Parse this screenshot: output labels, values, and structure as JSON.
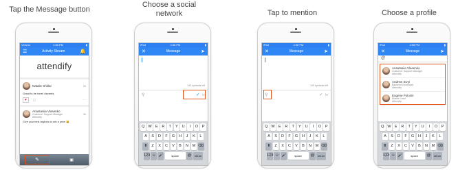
{
  "steps": [
    {
      "caption": "Tap the Message button"
    },
    {
      "caption": "Choose a social network"
    },
    {
      "caption": "Tap to mention"
    },
    {
      "caption": "Choose a profile"
    }
  ],
  "stream": {
    "status_left": "Verizon",
    "status_time": "4:58 PM",
    "title": "Activity Stream",
    "brand": "attendify",
    "post1": {
      "name": "Natalie Shklar",
      "time": "2h",
      "text": "Great to be here! #events"
    },
    "post2": {
      "name": "Anastasiia Vlasenko",
      "sub": "Customer Support Manager",
      "sub2": "Attendify",
      "time": "3h",
      "text": "Give your best taglines to win a prize 😀"
    }
  },
  "compose": {
    "status_left": "iPad",
    "status_time": "4:58 PM",
    "title": "Message",
    "chars": "140 symbols left"
  },
  "profiles": [
    {
      "name": "Anastasiia Vlasenko",
      "sub": "Customer Support Manager",
      "org": "Attendify"
    },
    {
      "name": "Andrew Sivyi",
      "sub": "Backend Developer",
      "org": "Attendify"
    },
    {
      "name": "Eugene Polosin",
      "sub": "Mobile Lead",
      "org": "Attendify"
    }
  ],
  "keyboard": {
    "row1": [
      "Q",
      "W",
      "E",
      "R",
      "T",
      "Y",
      "U",
      "I",
      "O",
      "P"
    ],
    "row2": [
      "A",
      "S",
      "D",
      "F",
      "G",
      "H",
      "J",
      "K",
      "L"
    ],
    "row3": [
      "Z",
      "X",
      "C",
      "V",
      "B",
      "N",
      "M"
    ],
    "space": "space",
    "ret": "return",
    "num": "123"
  },
  "accent": "#2e87f5",
  "highlight": "#e2551f"
}
